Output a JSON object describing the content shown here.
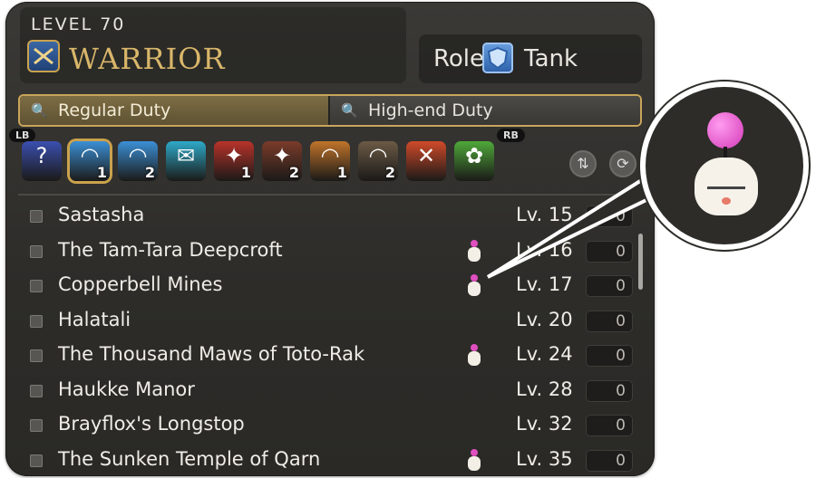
{
  "header": {
    "level_text": "LEVEL 70",
    "job_name": "WARRIOR",
    "job_icon": "warrior-job-icon",
    "role_label": "Role:",
    "role_icon": "tank-shield-icon",
    "role_value": "Tank"
  },
  "tabs": [
    {
      "label": "Regular Duty",
      "icon": "magnifier-icon",
      "active": true
    },
    {
      "label": "High-end Duty",
      "icon": "magnifier-icon",
      "active": false
    }
  ],
  "bumpers": {
    "left": "LB",
    "right": "RB"
  },
  "categories": [
    {
      "name": "roulette",
      "glyph": "?",
      "color": "#3a4fb0",
      "num": ""
    },
    {
      "name": "dungeons-1",
      "glyph": "◠",
      "color": "#3b8fd6",
      "num": "1",
      "selected": true
    },
    {
      "name": "dungeons-2",
      "glyph": "◠",
      "color": "#3b8fd6",
      "num": "2"
    },
    {
      "name": "guildhests",
      "glyph": "✉",
      "color": "#2ea9c9",
      "num": ""
    },
    {
      "name": "trials-1",
      "glyph": "✦",
      "color": "#b8332a",
      "num": "1"
    },
    {
      "name": "trials-2",
      "glyph": "✦",
      "color": "#7a3b2a",
      "num": "2"
    },
    {
      "name": "raids-1",
      "glyph": "◠",
      "color": "#c0742a",
      "num": "1"
    },
    {
      "name": "raids-2",
      "glyph": "◠",
      "color": "#6b5a45",
      "num": "2"
    },
    {
      "name": "pvp",
      "glyph": "✕",
      "color": "#d04a2a",
      "num": ""
    },
    {
      "name": "gold-saucer",
      "glyph": "✿",
      "color": "#4fa83a",
      "num": ""
    }
  ],
  "controls": {
    "sort_icon": "sort-arrows-icon",
    "refresh_icon": "refresh-icon"
  },
  "duties": [
    {
      "name": "Sastasha",
      "level": "Lv. 15",
      "count": "0",
      "moogle": false
    },
    {
      "name": "The Tam-Tara Deepcroft",
      "level": "Lv. 16",
      "count": "0",
      "moogle": true
    },
    {
      "name": "Copperbell Mines",
      "level": "Lv. 17",
      "count": "0",
      "moogle": true
    },
    {
      "name": "Halatali",
      "level": "Lv. 20",
      "count": "0",
      "moogle": false
    },
    {
      "name": "The Thousand Maws of Toto-Rak",
      "level": "Lv. 24",
      "count": "0",
      "moogle": true
    },
    {
      "name": "Haukke Manor",
      "level": "Lv. 28",
      "count": "0",
      "moogle": false
    },
    {
      "name": "Brayflox's Longstop",
      "level": "Lv. 32",
      "count": "0",
      "moogle": false
    },
    {
      "name": "The Sunken Temple of Qarn",
      "level": "Lv. 35",
      "count": "0",
      "moogle": true
    }
  ],
  "callout": {
    "icon": "moogle-icon"
  }
}
